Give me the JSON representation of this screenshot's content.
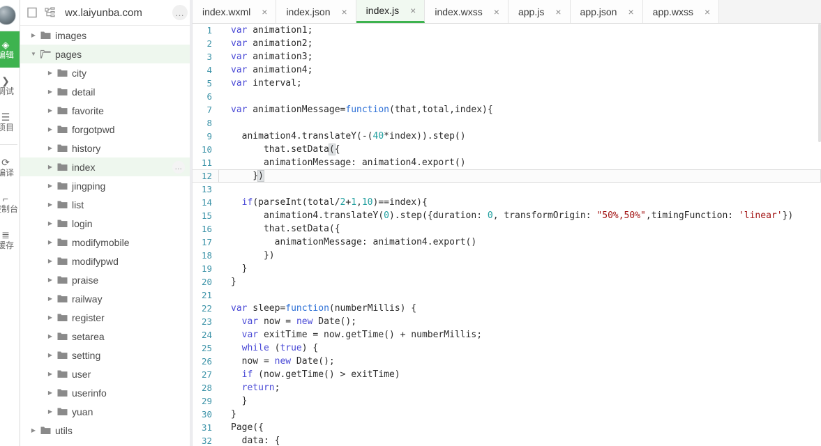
{
  "toolstrip": {
    "avatar_name": "user-avatar",
    "items": [
      {
        "label": "编辑",
        "icon": "edit-icon",
        "glyph": "◈",
        "active": true
      },
      {
        "label": "调试",
        "icon": "debug-icon",
        "glyph": "❯",
        "active": false
      },
      {
        "label": "项目",
        "icon": "project-icon",
        "glyph": "☰",
        "active": false
      },
      {
        "label": "编译",
        "icon": "compile-icon",
        "glyph": "⟳",
        "active": false
      },
      {
        "label": "控制台",
        "icon": "console-icon",
        "glyph": "⌐",
        "active": false
      },
      {
        "label": "缓存",
        "icon": "cache-icon",
        "glyph": "≣",
        "active": false
      }
    ]
  },
  "sidebar": {
    "header": {
      "panel_icon": "panel-toggle-icon",
      "tree_icon": "tree-structure-icon",
      "title": "wx.laiyunba.com",
      "more_label": "…",
      "more_icon": "more-options-icon"
    },
    "tree": [
      {
        "label": "images",
        "depth": 0,
        "expanded": false,
        "selected": false,
        "more": false
      },
      {
        "label": "pages",
        "depth": 0,
        "expanded": true,
        "selected": true,
        "more": false
      },
      {
        "label": "city",
        "depth": 1,
        "expanded": false,
        "selected": false,
        "more": false
      },
      {
        "label": "detail",
        "depth": 1,
        "expanded": false,
        "selected": false,
        "more": false
      },
      {
        "label": "favorite",
        "depth": 1,
        "expanded": false,
        "selected": false,
        "more": false
      },
      {
        "label": "forgotpwd",
        "depth": 1,
        "expanded": false,
        "selected": false,
        "more": false
      },
      {
        "label": "history",
        "depth": 1,
        "expanded": false,
        "selected": false,
        "more": false
      },
      {
        "label": "index",
        "depth": 1,
        "expanded": false,
        "selected": true,
        "more": true
      },
      {
        "label": "jingping",
        "depth": 1,
        "expanded": false,
        "selected": false,
        "more": false
      },
      {
        "label": "list",
        "depth": 1,
        "expanded": false,
        "selected": false,
        "more": false
      },
      {
        "label": "login",
        "depth": 1,
        "expanded": false,
        "selected": false,
        "more": false
      },
      {
        "label": "modifymobile",
        "depth": 1,
        "expanded": false,
        "selected": false,
        "more": false
      },
      {
        "label": "modifypwd",
        "depth": 1,
        "expanded": false,
        "selected": false,
        "more": false
      },
      {
        "label": "praise",
        "depth": 1,
        "expanded": false,
        "selected": false,
        "more": false
      },
      {
        "label": "railway",
        "depth": 1,
        "expanded": false,
        "selected": false,
        "more": false
      },
      {
        "label": "register",
        "depth": 1,
        "expanded": false,
        "selected": false,
        "more": false
      },
      {
        "label": "setarea",
        "depth": 1,
        "expanded": false,
        "selected": false,
        "more": false
      },
      {
        "label": "setting",
        "depth": 1,
        "expanded": false,
        "selected": false,
        "more": false
      },
      {
        "label": "user",
        "depth": 1,
        "expanded": false,
        "selected": false,
        "more": false
      },
      {
        "label": "userinfo",
        "depth": 1,
        "expanded": false,
        "selected": false,
        "more": false
      },
      {
        "label": "yuan",
        "depth": 1,
        "expanded": false,
        "selected": false,
        "more": false
      },
      {
        "label": "utils",
        "depth": 0,
        "expanded": false,
        "selected": false,
        "more": false
      }
    ],
    "row_more_label": "…"
  },
  "editor": {
    "tabs": [
      {
        "label": "index.wxml",
        "active": false,
        "close": "×"
      },
      {
        "label": "index.json",
        "active": false,
        "close": "×"
      },
      {
        "label": "index.js",
        "active": true,
        "close": "×"
      },
      {
        "label": "index.wxss",
        "active": false,
        "close": "×"
      },
      {
        "label": "app.js",
        "active": false,
        "close": "×"
      },
      {
        "label": "app.json",
        "active": false,
        "close": "×"
      },
      {
        "label": "app.wxss",
        "active": false,
        "close": "×"
      }
    ],
    "accent_color": "#3eb34f",
    "current_line": 12,
    "lines": [
      {
        "n": 1,
        "tokens": [
          {
            "t": "var",
            "c": "kw"
          },
          {
            "t": " animation1;",
            "c": ""
          }
        ]
      },
      {
        "n": 2,
        "tokens": [
          {
            "t": "var",
            "c": "kw"
          },
          {
            "t": " animation2;",
            "c": ""
          }
        ]
      },
      {
        "n": 3,
        "tokens": [
          {
            "t": "var",
            "c": "kw"
          },
          {
            "t": " animation3;",
            "c": ""
          }
        ]
      },
      {
        "n": 4,
        "tokens": [
          {
            "t": "var",
            "c": "kw"
          },
          {
            "t": " animation4;",
            "c": ""
          }
        ]
      },
      {
        "n": 5,
        "tokens": [
          {
            "t": "var",
            "c": "kw"
          },
          {
            "t": " interval;",
            "c": ""
          }
        ]
      },
      {
        "n": 6,
        "tokens": []
      },
      {
        "n": 7,
        "tokens": [
          {
            "t": "var",
            "c": "kw"
          },
          {
            "t": " animationMessage=",
            "c": ""
          },
          {
            "t": "function",
            "c": "fn"
          },
          {
            "t": "(that,total,index){",
            "c": ""
          }
        ]
      },
      {
        "n": 8,
        "tokens": []
      },
      {
        "n": 9,
        "tokens": [
          {
            "t": "  animation4.translateY(-(",
            "c": ""
          },
          {
            "t": "40",
            "c": "num"
          },
          {
            "t": "*index)).step()",
            "c": ""
          }
        ]
      },
      {
        "n": 10,
        "tokens": [
          {
            "t": "      that.setData",
            "c": ""
          },
          {
            "t": "(",
            "c": "bmatch"
          },
          {
            "t": "{",
            "c": ""
          }
        ]
      },
      {
        "n": 11,
        "tokens": [
          {
            "t": "      animationMessage: animation4.export()",
            "c": ""
          }
        ]
      },
      {
        "n": 12,
        "tokens": [
          {
            "t": "    }",
            "c": ""
          },
          {
            "t": ")",
            "c": "bmatch"
          }
        ]
      },
      {
        "n": 13,
        "tokens": []
      },
      {
        "n": 14,
        "tokens": [
          {
            "t": "  ",
            "c": ""
          },
          {
            "t": "if",
            "c": "kw"
          },
          {
            "t": "(parseInt(total/",
            "c": ""
          },
          {
            "t": "2",
            "c": "num"
          },
          {
            "t": "+",
            "c": ""
          },
          {
            "t": "1",
            "c": "num"
          },
          {
            "t": ",",
            "c": ""
          },
          {
            "t": "10",
            "c": "num"
          },
          {
            "t": ")==index){",
            "c": ""
          }
        ]
      },
      {
        "n": 15,
        "tokens": [
          {
            "t": "      animation4.translateY(",
            "c": ""
          },
          {
            "t": "0",
            "c": "num"
          },
          {
            "t": ").step({duration: ",
            "c": ""
          },
          {
            "t": "0",
            "c": "num"
          },
          {
            "t": ", transformOrigin: ",
            "c": ""
          },
          {
            "t": "\"50%,50%\"",
            "c": "str"
          },
          {
            "t": ",timingFunction: ",
            "c": ""
          },
          {
            "t": "'linear'",
            "c": "str"
          },
          {
            "t": "})",
            "c": ""
          }
        ]
      },
      {
        "n": 16,
        "tokens": [
          {
            "t": "      that.setData({",
            "c": ""
          }
        ]
      },
      {
        "n": 17,
        "tokens": [
          {
            "t": "        animationMessage: animation4.export()",
            "c": ""
          }
        ]
      },
      {
        "n": 18,
        "tokens": [
          {
            "t": "      })",
            "c": ""
          }
        ]
      },
      {
        "n": 19,
        "tokens": [
          {
            "t": "  }",
            "c": ""
          }
        ]
      },
      {
        "n": 20,
        "tokens": [
          {
            "t": "}",
            "c": ""
          }
        ]
      },
      {
        "n": 21,
        "tokens": []
      },
      {
        "n": 22,
        "tokens": [
          {
            "t": "var",
            "c": "kw"
          },
          {
            "t": " sleep=",
            "c": ""
          },
          {
            "t": "function",
            "c": "fn"
          },
          {
            "t": "(numberMillis) {",
            "c": ""
          }
        ]
      },
      {
        "n": 23,
        "tokens": [
          {
            "t": "  ",
            "c": ""
          },
          {
            "t": "var",
            "c": "kw"
          },
          {
            "t": " now = ",
            "c": ""
          },
          {
            "t": "new",
            "c": "kw"
          },
          {
            "t": " Date();",
            "c": ""
          }
        ]
      },
      {
        "n": 24,
        "tokens": [
          {
            "t": "  ",
            "c": ""
          },
          {
            "t": "var",
            "c": "kw"
          },
          {
            "t": " exitTime = now.getTime() + numberMillis;",
            "c": ""
          }
        ]
      },
      {
        "n": 25,
        "tokens": [
          {
            "t": "  ",
            "c": ""
          },
          {
            "t": "while",
            "c": "kw"
          },
          {
            "t": " (",
            "c": ""
          },
          {
            "t": "true",
            "c": "kw"
          },
          {
            "t": ") {",
            "c": ""
          }
        ]
      },
      {
        "n": 26,
        "tokens": [
          {
            "t": "  now = ",
            "c": ""
          },
          {
            "t": "new",
            "c": "kw"
          },
          {
            "t": " Date();",
            "c": ""
          }
        ]
      },
      {
        "n": 27,
        "tokens": [
          {
            "t": "  ",
            "c": ""
          },
          {
            "t": "if",
            "c": "kw"
          },
          {
            "t": " (now.getTime() > exitTime)",
            "c": ""
          }
        ]
      },
      {
        "n": 28,
        "tokens": [
          {
            "t": "  ",
            "c": ""
          },
          {
            "t": "return",
            "c": "kw"
          },
          {
            "t": ";",
            "c": ""
          }
        ]
      },
      {
        "n": 29,
        "tokens": [
          {
            "t": "  }",
            "c": ""
          }
        ]
      },
      {
        "n": 30,
        "tokens": [
          {
            "t": "}",
            "c": ""
          }
        ]
      },
      {
        "n": 31,
        "tokens": [
          {
            "t": "Page({",
            "c": ""
          }
        ]
      },
      {
        "n": 32,
        "tokens": [
          {
            "t": "  data: {",
            "c": ""
          }
        ]
      }
    ]
  }
}
